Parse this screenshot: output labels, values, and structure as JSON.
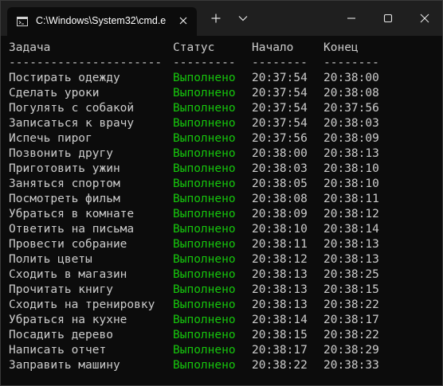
{
  "window": {
    "tab_title": "C:\\Windows\\System32\\cmd.e",
    "icons": {
      "tab": "terminal-icon",
      "close_tab": "close-icon",
      "new_tab": "plus-icon",
      "dropdown": "chevron-down-icon",
      "minimize": "minimize-icon",
      "maximize": "maximize-icon",
      "close_window": "close-icon"
    }
  },
  "table": {
    "headers": [
      "Задача",
      "Статус",
      "Начало",
      "Конец"
    ],
    "separators": [
      "----------------------",
      "---------",
      "--------",
      "--------"
    ],
    "status_color": "#16c60c",
    "rows": [
      {
        "task": "Постирать одежду",
        "status": "Выполнено",
        "start": "20:37:54",
        "end": "20:38:00"
      },
      {
        "task": "Сделать уроки",
        "status": "Выполнено",
        "start": "20:37:54",
        "end": "20:38:08"
      },
      {
        "task": "Погулять с собакой",
        "status": "Выполнено",
        "start": "20:37:54",
        "end": "20:37:56"
      },
      {
        "task": "Записаться к врачу",
        "status": "Выполнено",
        "start": "20:37:54",
        "end": "20:38:03"
      },
      {
        "task": "Испечь пирог",
        "status": "Выполнено",
        "start": "20:37:56",
        "end": "20:38:09"
      },
      {
        "task": "Позвонить другу",
        "status": "Выполнено",
        "start": "20:38:00",
        "end": "20:38:13"
      },
      {
        "task": "Приготовить ужин",
        "status": "Выполнено",
        "start": "20:38:03",
        "end": "20:38:10"
      },
      {
        "task": "Заняться спортом",
        "status": "Выполнено",
        "start": "20:38:05",
        "end": "20:38:10"
      },
      {
        "task": "Посмотреть фильм",
        "status": "Выполнено",
        "start": "20:38:08",
        "end": "20:38:11"
      },
      {
        "task": "Убраться в комнате",
        "status": "Выполнено",
        "start": "20:38:09",
        "end": "20:38:12"
      },
      {
        "task": "Ответить на письма",
        "status": "Выполнено",
        "start": "20:38:10",
        "end": "20:38:14"
      },
      {
        "task": "Провести собрание",
        "status": "Выполнено",
        "start": "20:38:11",
        "end": "20:38:13"
      },
      {
        "task": "Полить цветы",
        "status": "Выполнено",
        "start": "20:38:12",
        "end": "20:38:13"
      },
      {
        "task": "Сходить в магазин",
        "status": "Выполнено",
        "start": "20:38:13",
        "end": "20:38:25"
      },
      {
        "task": "Прочитать книгу",
        "status": "Выполнено",
        "start": "20:38:13",
        "end": "20:38:15"
      },
      {
        "task": "Сходить на тренировку",
        "status": "Выполнено",
        "start": "20:38:13",
        "end": "20:38:22"
      },
      {
        "task": "Убраться на кухне",
        "status": "Выполнено",
        "start": "20:38:14",
        "end": "20:38:17"
      },
      {
        "task": "Посадить дерево",
        "status": "Выполнено",
        "start": "20:38:15",
        "end": "20:38:22"
      },
      {
        "task": "Написать отчет",
        "status": "Выполнено",
        "start": "20:38:17",
        "end": "20:38:29"
      },
      {
        "task": "Заправить машину",
        "status": "Выполнено",
        "start": "20:38:22",
        "end": "20:38:33"
      }
    ]
  }
}
